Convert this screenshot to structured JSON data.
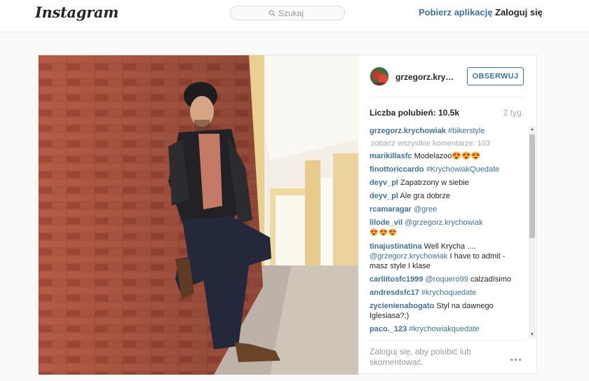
{
  "topbar": {
    "logo": "Instagram",
    "search_placeholder": "Szukaj",
    "get_app": "Pobierz aplikację",
    "login": "Zaloguj się"
  },
  "post": {
    "username": "grzegorz.krych…",
    "follow_label": "OBSERWUJ",
    "likes": "Liczba polubień: 10.5k",
    "age": "2 tyg.",
    "caption_user": "grzegorz.krychowiak",
    "caption_tag": "#bikerstyle",
    "view_all": "zobacz wszystkie komentarze: 103",
    "comments": [
      {
        "user": "marikillasfc",
        "text": "Modelazoo😍😍😍"
      },
      {
        "user": "finottoriccardo",
        "tag": "#KrychowiakQuedate"
      },
      {
        "user": "deyv_pl",
        "text": "Zapatrzony w siebie"
      },
      {
        "user": "deyv_pl",
        "text": "Ale gra dobrze"
      },
      {
        "user": "rcamaragar",
        "mention": "@gree"
      },
      {
        "user": "lilode_vil",
        "mention": "@grzegorz.krychowiak",
        "text": "😍😍😍"
      },
      {
        "user": "tinajustinatina",
        "text": "Well Krycha ....",
        "mention": "@grzegorz.krychowiak",
        "text2": "I have to admit - masz style I klase"
      },
      {
        "user": "carliitosfc1999",
        "mention": "@roquero99",
        "text": "calzadísimo"
      },
      {
        "user": "andresdsfc17",
        "tag": "#krychoquedate"
      },
      {
        "user": "zycienienabogato",
        "text": "Styl na dawnego Iglesiasa?;)"
      },
      {
        "user": "paco._123",
        "tag": "#krychowiakquedate"
      }
    ],
    "footer_login": "Zaloguj się",
    "footer_rest": ", aby polubić lub skomentować.",
    "more": "•••"
  },
  "colors": {
    "link": "#3f729b",
    "muted": "#a5a7aa",
    "brick": "#b5523d"
  }
}
